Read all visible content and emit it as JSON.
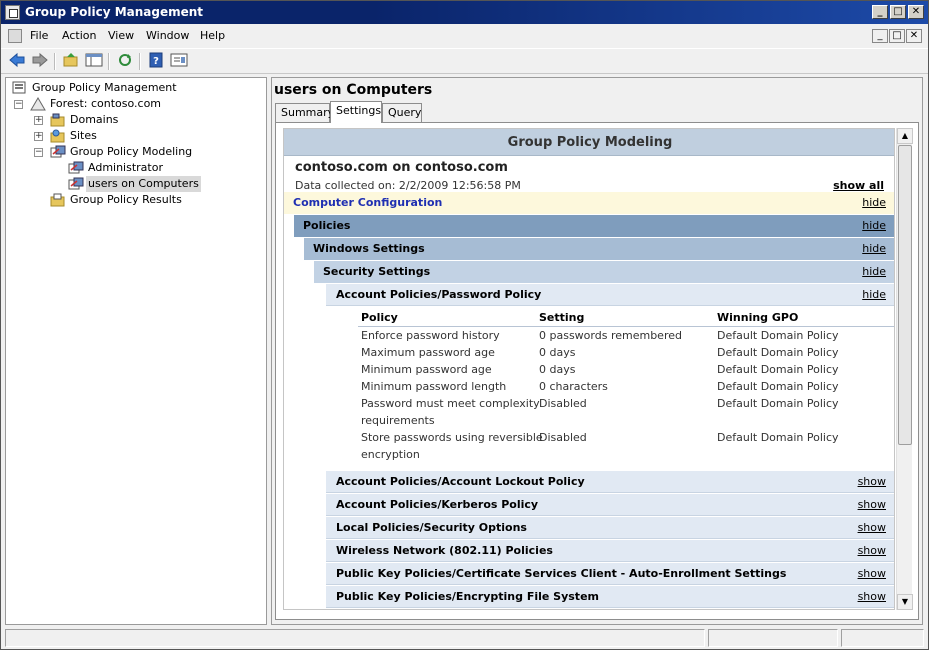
{
  "window": {
    "title": "Group Policy Management",
    "minimize_glyph": "_",
    "maximize_glyph": "□",
    "close_glyph": "✕"
  },
  "menu": {
    "items": [
      "File",
      "Action",
      "View",
      "Window",
      "Help"
    ]
  },
  "toolbar": {
    "buttons": [
      "back-icon",
      "forward-icon",
      "up-folder-icon",
      "show-hide-tree-icon",
      "refresh-icon",
      "help-icon",
      "properties-icon"
    ]
  },
  "tree": {
    "root": "Group Policy Management",
    "forest": "Forest: contoso.com",
    "domains": "Domains",
    "sites": "Sites",
    "modeling": "Group Policy Modeling",
    "administrator": "Administrator",
    "users_on_computers": "users on Computers",
    "results": "Group Policy Results",
    "expand_plus": "+",
    "expand_minus": "−"
  },
  "right": {
    "title": "users on Computers",
    "tabs": [
      "Summary",
      "Settings",
      "Query"
    ]
  },
  "report": {
    "header": "Group Policy Modeling",
    "subtitle": "contoso.com on contoso.com",
    "collected": "Data collected on: 2/2/2009 12:56:58 PM",
    "show_all": "show all",
    "computer_configuration": "Computer Configuration",
    "policies": "Policies",
    "windows_settings": "Windows Settings",
    "security_settings": "Security Settings",
    "password_policy": "Account Policies/Password Policy",
    "hide": "hide",
    "show": "show",
    "table": {
      "headers": [
        "Policy",
        "Setting",
        "Winning GPO"
      ],
      "rows": [
        [
          "Enforce password history",
          "",
          "0 passwords remembered",
          "Default Domain Policy"
        ],
        [
          "Maximum password age",
          "",
          "0 days",
          "Default Domain Policy"
        ],
        [
          "Minimum password age",
          "",
          "0 days",
          "Default Domain Policy"
        ],
        [
          "Minimum password length",
          "",
          "0 characters",
          "Default Domain Policy"
        ],
        [
          "Password must meet complexity",
          "requirements",
          "Disabled",
          "Default Domain Policy"
        ],
        [
          "Store passwords using reversible",
          "encryption",
          "Disabled",
          "Default Domain Policy"
        ]
      ]
    },
    "collapsed_sections": [
      "Account Policies/Account Lockout Policy",
      "Account Policies/Kerberos Policy",
      "Local Policies/Security Options",
      "Wireless Network (802.11) Policies",
      "Public Key Policies/Certificate Services Client - Auto-Enrollment Settings",
      "Public Key Policies/Encrypting File System"
    ]
  },
  "scrollbar": {
    "up_glyph": "▲",
    "down_glyph": "▼"
  }
}
